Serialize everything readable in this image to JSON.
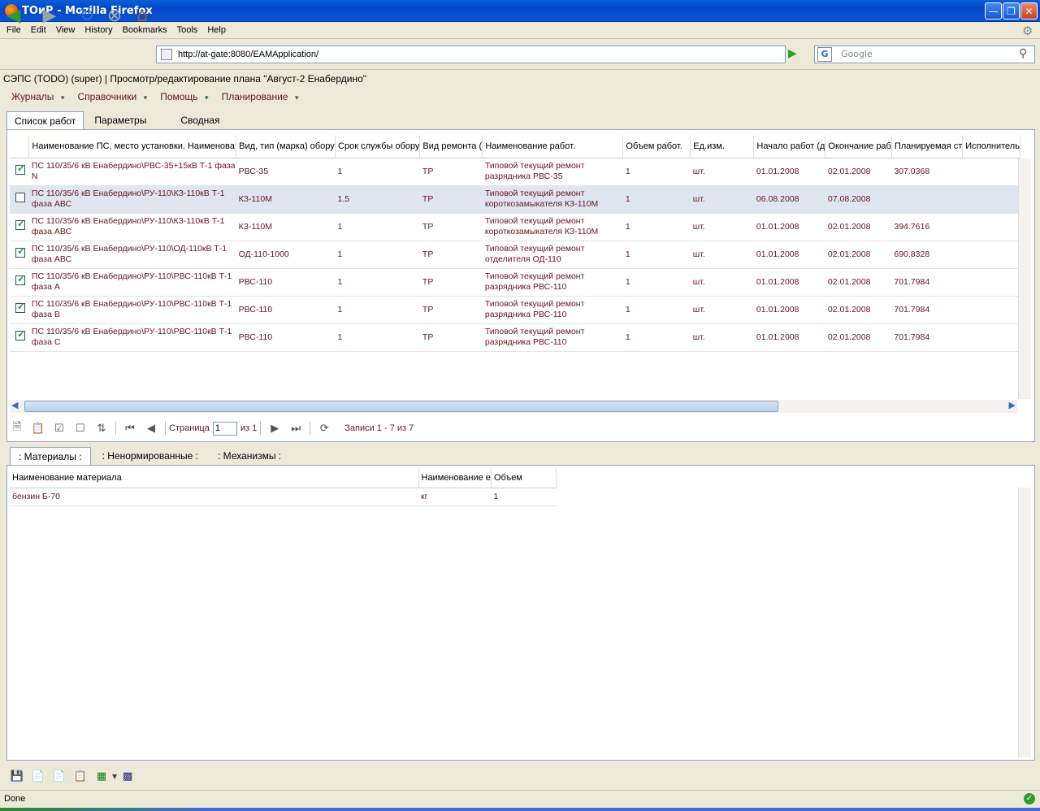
{
  "window": {
    "title": "ТОиР - Mozilla Firefox"
  },
  "menubar": [
    "File",
    "Edit",
    "View",
    "History",
    "Bookmarks",
    "Tools",
    "Help"
  ],
  "nav": {
    "url": "http://at-gate:8080/EAMApplication/",
    "search_placeholder": "Google"
  },
  "app": {
    "header": "СЭПС (TODO) (super) | Просмотр/редактирование плана \"Август-2 Енабердино\"",
    "menu": [
      "Журналы",
      "Справочники",
      "Помощь",
      "Планирование"
    ],
    "tabs": [
      "Список работ",
      "Параметры",
      "Сводная"
    ],
    "columns": [
      "Наименование ПС, место установки. Наименова",
      "Вид, тип (марка) обору",
      "Срок службы обору",
      "Вид ремонта (",
      "Наименование работ.",
      "Объем работ.",
      "Ед.изм.",
      "Начало работ (д",
      "Окончание раб",
      "Планируемая ст",
      "Исполнитель"
    ],
    "rows": [
      {
        "checked": true,
        "name": "ПС 110/35/6 кВ Енабердино\\РВС-35+15кВ Т-1 фаза N",
        "type": "РВС-35",
        "life": "1",
        "repair": "ТР",
        "work": "Типовой текущий ремонт разрядника РВС-35",
        "volume": "1",
        "unit": "шт.",
        "start": "01.01.2008",
        "end": "02.01.2008",
        "cost": "307.0368"
      },
      {
        "checked": false,
        "name": "ПС 110/35/6 кВ Енабердино\\РУ-110\\КЗ-110кВ Т-1 фаза АВС",
        "type": "КЗ-110М",
        "life": "1.5",
        "repair": "ТР",
        "work": "Типовой текущий ремонт короткозамыкателя КЗ-110М",
        "volume": "1",
        "unit": "шт.",
        "start": "06.08.2008",
        "end": "07.08.2008",
        "cost": ""
      },
      {
        "checked": true,
        "name": "ПС 110/35/6 кВ Енабердино\\РУ-110\\КЗ-110кВ Т-1 фаза АВС",
        "type": "КЗ-110М",
        "life": "1",
        "repair": "ТР",
        "work": "Типовой текущий ремонт короткозамыкателя КЗ-110М",
        "volume": "1",
        "unit": "шт.",
        "start": "01.01.2008",
        "end": "02.01.2008",
        "cost": "394.7616"
      },
      {
        "checked": true,
        "name": "ПС 110/35/6 кВ Енабердино\\РУ-110\\ОД-110кВ Т-1 фаза АВС",
        "type": "ОД-110-1000",
        "life": "1",
        "repair": "ТР",
        "work": "Типовой текущий ремонт отделителя ОД-110",
        "volume": "1",
        "unit": "шт.",
        "start": "01.01.2008",
        "end": "02.01.2008",
        "cost": "690.8328"
      },
      {
        "checked": true,
        "name": "ПС 110/35/6 кВ Енабердино\\РУ-110\\РВС-110кВ Т-1 фаза А",
        "type": "РВС-110",
        "life": "1",
        "repair": "ТР",
        "work": "Типовой текущий ремонт разрядника РВС-110",
        "volume": "1",
        "unit": "шт.",
        "start": "01.01.2008",
        "end": "02.01.2008",
        "cost": "701.7984"
      },
      {
        "checked": true,
        "name": "ПС 110/35/6 кВ Енабердино\\РУ-110\\РВС-110кВ Т-1 фаза В",
        "type": "РВС-110",
        "life": "1",
        "repair": "ТР",
        "work": "Типовой текущий ремонт разрядника РВС-110",
        "volume": "1",
        "unit": "шт.",
        "start": "01.01.2008",
        "end": "02.01.2008",
        "cost": "701.7984"
      },
      {
        "checked": true,
        "name": "ПС 110/35/6 кВ Енабердино\\РУ-110\\РВС-110кВ Т-1 фаза С",
        "type": "РВС-110",
        "life": "1",
        "repair": "ТР",
        "work": "Типовой текущий ремонт разрядника РВС-110",
        "volume": "1",
        "unit": "шт.",
        "start": "01.01.2008",
        "end": "02.01.2008",
        "cost": "701.7984"
      }
    ],
    "pager": {
      "page_label": "Страница",
      "page_value": "1",
      "of_label": "из 1",
      "records": "Записи 1 - 7 из 7"
    },
    "subtabs": [
      ": Материалы :",
      ": Ненормированные :",
      ": Механизмы :"
    ],
    "subcolumns": [
      "Наименование материала",
      "Наименование е",
      "Объем"
    ],
    "subrows": [
      {
        "name": "бензин Б-70",
        "unit": "кг",
        "volume": "1"
      }
    ]
  },
  "status": "Done"
}
